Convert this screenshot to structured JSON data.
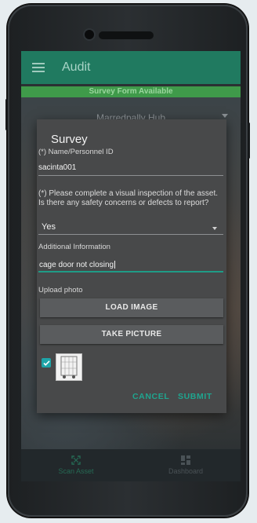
{
  "app": {
    "title": "Audit",
    "banner": "Survey Form Available",
    "hub": "Marredpally Hub"
  },
  "dialog": {
    "title": "Survey",
    "name_label": "(*) Name/Personnel ID",
    "name_value": "sacinta001",
    "question": "(*) Please complete a visual inspection of the asset. Is there any safety concerns or defects to report?",
    "answer": "Yes",
    "additional_label": "Additional Information",
    "additional_value": "cage door not closing",
    "upload_label": "Upload photo",
    "load_image": "LOAD IMAGE",
    "take_picture": "TAKE PICTURE",
    "photo_checked": true,
    "cancel": "CANCEL",
    "submit": "SUBMIT"
  },
  "bottom_nav": {
    "scan": "Scan Asset",
    "dashboard": "Dashboard"
  },
  "colors": {
    "accent": "#1fa58f",
    "appbar": "#207a60",
    "banner": "#3f9a4a",
    "dialog": "#48494a"
  }
}
